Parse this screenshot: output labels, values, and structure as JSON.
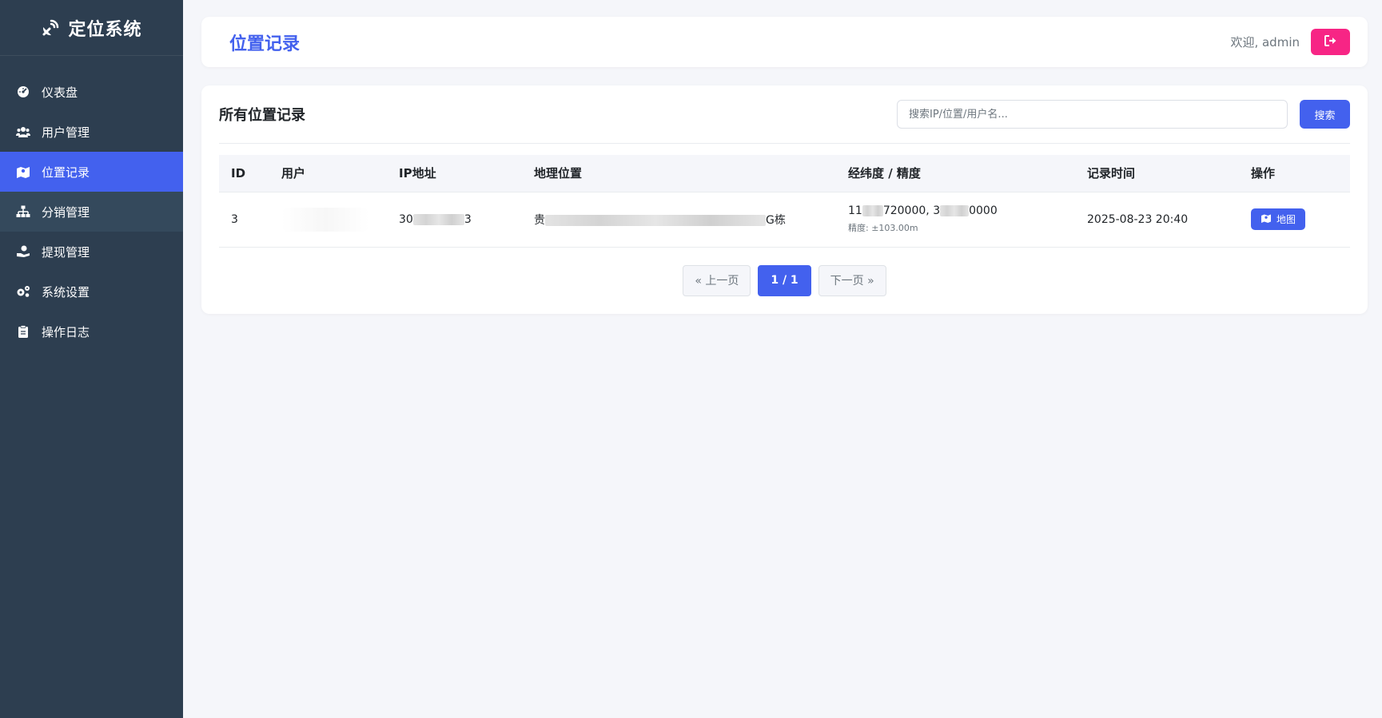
{
  "brand": {
    "title": "定位系统",
    "icon": "satellite-dish-icon"
  },
  "sidebar": {
    "items": [
      {
        "label": "仪表盘",
        "icon": "dashboard-gauge-icon"
      },
      {
        "label": "用户管理",
        "icon": "users-icon"
      },
      {
        "label": "位置记录",
        "icon": "map-icon",
        "active": true
      },
      {
        "label": "分销管理",
        "icon": "sitemap-icon"
      },
      {
        "label": "提现管理",
        "icon": "hand-holding-dollar-icon"
      },
      {
        "label": "系统设置",
        "icon": "gears-icon"
      },
      {
        "label": "操作日志",
        "icon": "clipboard-icon"
      }
    ]
  },
  "header": {
    "title": "位置记录",
    "welcome": "欢迎, admin",
    "logout_icon": "sign-out-icon"
  },
  "card": {
    "title": "所有位置记录",
    "search": {
      "placeholder": "搜索IP/位置/用户名...",
      "value": "",
      "button_label": "搜索"
    }
  },
  "table": {
    "columns": [
      "ID",
      "用户",
      "IP地址",
      "地理位置",
      "经纬度 / 精度",
      "记录时间",
      "操作"
    ],
    "rows": [
      {
        "id": "3",
        "ip_prefix": "30",
        "ip_suffix": "3",
        "location_prefix": "贵",
        "location_suffix": "G栋",
        "lng_prefix": "11",
        "lng_suffix": "720000,",
        "lat_prefix": "3",
        "lat_suffix": "0000",
        "accuracy": "精度: ±103.00m",
        "time": "2025-08-23 20:40",
        "action_label": "地图"
      }
    ]
  },
  "pagination": {
    "prev": "« 上一页",
    "current": "1 / 1",
    "next": "下一页 »"
  },
  "colors": {
    "sidebar_bg": "#2d3e50",
    "accent": "#4361ee",
    "danger": "#f72585",
    "page_bg": "#f5f6fa"
  }
}
